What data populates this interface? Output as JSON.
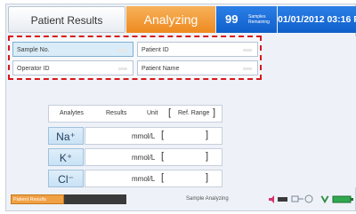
{
  "header": {
    "results_tab": "Patient Results",
    "analyzing_tab": "Analyzing",
    "samples_count": "99",
    "samples_text": "Samples Remaining",
    "datetime": "01/01/2012 03:16 PM"
  },
  "fields": {
    "sample_no": "Sample No.",
    "patient_id": "Patient ID",
    "operator_id": "Operator ID",
    "patient_name": "Patient Name"
  },
  "analytes": {
    "headers": {
      "analytes": "Analytes",
      "results": "Results",
      "unit": "Unit",
      "ref_open": "[",
      "ref_range": "Ref. Range",
      "ref_close": "]"
    },
    "rows": [
      {
        "name": "Na⁺",
        "unit": "mmol/L",
        "open": "[",
        "close": "]"
      },
      {
        "name": "K⁺",
        "unit": "mmol/L",
        "open": "[",
        "close": "]"
      },
      {
        "name": "Cl⁻",
        "unit": "mmol/L",
        "open": "[",
        "close": "]"
      }
    ]
  },
  "footer": {
    "results_pill": "Patient Results",
    "status": "Sample Analyzing"
  },
  "colors": {
    "accent_orange": "#ee8a1f",
    "accent_blue": "#0f5fc9",
    "highlight_red": "#d8171b"
  },
  "icons": [
    "speaker-icon",
    "battery-icon",
    "network-icon",
    "printer-icon",
    "plug-icon"
  ]
}
